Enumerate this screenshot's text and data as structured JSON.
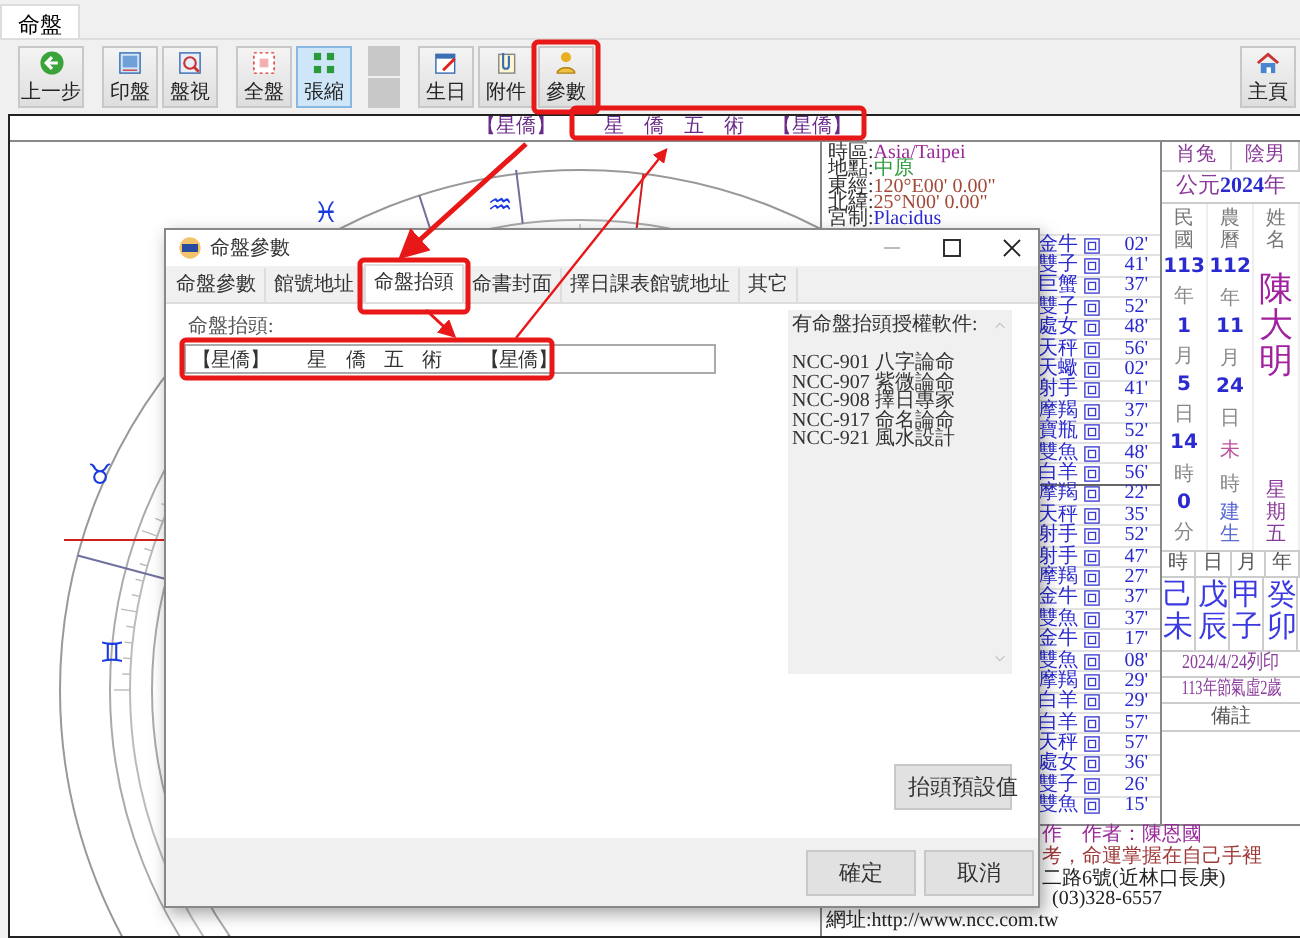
{
  "app_tabs": [
    {
      "label": "命盤",
      "selected": true
    }
  ],
  "toolbar": {
    "groups": [
      {
        "buttons": [
          {
            "label": "上一步",
            "selected": false
          }
        ]
      },
      {
        "buttons": [
          {
            "label": "印盤",
            "selected": false
          },
          {
            "label": "盤視",
            "selected": false
          }
        ]
      },
      {
        "buttons": [
          {
            "label": "全盤",
            "selected": false
          },
          {
            "label": "張縮",
            "selected": true
          }
        ]
      },
      {
        "buttons": [
          {
            "label": "生日",
            "selected": false
          },
          {
            "label": "附件",
            "selected": false
          },
          {
            "label": "參數",
            "selected": false
          }
        ]
      }
    ],
    "home_button": {
      "label": "主頁"
    }
  },
  "chart_header": [
    "【星僑】",
    "星　僑　五　術",
    "【星僑】"
  ],
  "wheel_signs": [
    "♓",
    "♒",
    "♉",
    "♊"
  ],
  "location": [
    {
      "label": "時區:",
      "value": "Asia/Taipei"
    },
    {
      "label": "地點:",
      "value": "中原"
    },
    {
      "label": "東經:",
      "value": "120°E00' 0.00\""
    },
    {
      "label": "北緯:",
      "value": "25°N00' 0.00\""
    },
    {
      "label": "宮制:",
      "value": "Placidus"
    }
  ],
  "positions": [
    {
      "sign": "金牛",
      "degree": "02'"
    },
    {
      "sign": "雙子",
      "degree": "41'"
    },
    {
      "sign": "巨蟹",
      "degree": "37'"
    },
    {
      "sign": "雙子",
      "degree": "52'"
    },
    {
      "sign": "處女",
      "degree": "48'"
    },
    {
      "sign": "天秤",
      "degree": "56'"
    },
    {
      "sign": "天蠍",
      "degree": "02'"
    },
    {
      "sign": "射手",
      "degree": "41'"
    },
    {
      "sign": "摩羯",
      "degree": "37'"
    },
    {
      "sign": "寶瓶",
      "degree": "52'"
    },
    {
      "sign": "雙魚",
      "degree": "48'"
    },
    {
      "sign": "白羊",
      "degree": "56'"
    },
    {
      "sign": "摩羯",
      "degree": "22'"
    },
    {
      "sign": "天秤",
      "degree": "35'"
    },
    {
      "sign": "射手",
      "degree": "52'"
    },
    {
      "sign": "射手",
      "degree": "47'"
    },
    {
      "sign": "摩羯",
      "degree": "27'"
    },
    {
      "sign": "金牛",
      "degree": "37'"
    },
    {
      "sign": "雙魚",
      "degree": "37'"
    },
    {
      "sign": "金牛",
      "degree": "17'"
    },
    {
      "sign": "雙魚",
      "degree": "08'"
    },
    {
      "sign": "摩羯",
      "degree": "29'"
    },
    {
      "sign": "白羊",
      "degree": "29'"
    },
    {
      "sign": "白羊",
      "degree": "57'"
    },
    {
      "sign": "天秤",
      "degree": "57'"
    },
    {
      "sign": "處女",
      "degree": "36'"
    },
    {
      "sign": "雙子",
      "degree": "26'"
    },
    {
      "sign": "雙魚",
      "degree": "15'"
    }
  ],
  "profile": {
    "zodiac": "肖兔",
    "gender": "陰男",
    "year_line": "公元**2024**年",
    "columns": [
      {
        "heading": "民國",
        "entries": [
          {
            "text": "113",
            "kind": "number"
          },
          {
            "text": "年",
            "kind": "unit"
          },
          {
            "text": "1",
            "kind": "number"
          },
          {
            "text": "月",
            "kind": "unit"
          },
          {
            "text": "5",
            "kind": "number"
          },
          {
            "text": "日",
            "kind": "unit"
          },
          {
            "text": "14",
            "kind": "number"
          },
          {
            "text": "時",
            "kind": "unit"
          },
          {
            "text": "0",
            "kind": "number"
          },
          {
            "text": "分",
            "kind": "unit"
          }
        ]
      },
      {
        "heading": "農曆",
        "entries": [
          {
            "text": "112",
            "kind": "number"
          },
          {
            "text": "年",
            "kind": "unit"
          },
          {
            "text": "11",
            "kind": "number"
          },
          {
            "text": "月",
            "kind": "unit"
          },
          {
            "text": "24",
            "kind": "number"
          },
          {
            "text": "日",
            "kind": "unit"
          },
          {
            "text": "未",
            "kind": "branch"
          },
          {
            "text": "時",
            "kind": "unit"
          },
          {
            "text": "建生",
            "kind": "note"
          }
        ]
      }
    ],
    "name_heading": "姓名",
    "name": "陳大明",
    "weekday": "星期五",
    "pillars": [
      {
        "heading": "時",
        "value": "己未"
      },
      {
        "heading": "日",
        "value": "戊辰"
      },
      {
        "heading": "月",
        "value": "甲子"
      },
      {
        "heading": "年",
        "value": "癸卯"
      }
    ],
    "print_date": "2024/4/24列印",
    "age_note": "113年節氣虛2歲",
    "remarks_heading": "備註"
  },
  "footer_lines": [
    "作　作者：陳恩國",
    "考，命運掌握在自己手裡",
    "二路6號(近林口長庚)",
    "(03)328-6557",
    "網址:http://www.ncc.com.tw"
  ],
  "dialog": {
    "title": "命盤參數",
    "tabs": [
      {
        "label": "命盤參數",
        "selected": false
      },
      {
        "label": "館號地址",
        "selected": false
      },
      {
        "label": "命盤抬頭",
        "selected": true
      },
      {
        "label": "命書封面",
        "selected": false
      },
      {
        "label": "擇日課表館號地址",
        "selected": false
      },
      {
        "label": "其它",
        "selected": false
      }
    ],
    "field_label": "命盤抬頭:",
    "field_value": "【星僑】　　星　僑　五　術　　【星僑】",
    "licensed": {
      "title": "有命盤抬頭授權軟件:",
      "items": [
        "NCC-901 八字論命",
        "NCC-907 紫微論命",
        "NCC-908 擇日專家",
        "NCC-917 命名論命",
        "NCC-921 風水設計"
      ]
    },
    "default_button": "抬頭預設值",
    "buttons": [
      "確定",
      "取消"
    ]
  }
}
